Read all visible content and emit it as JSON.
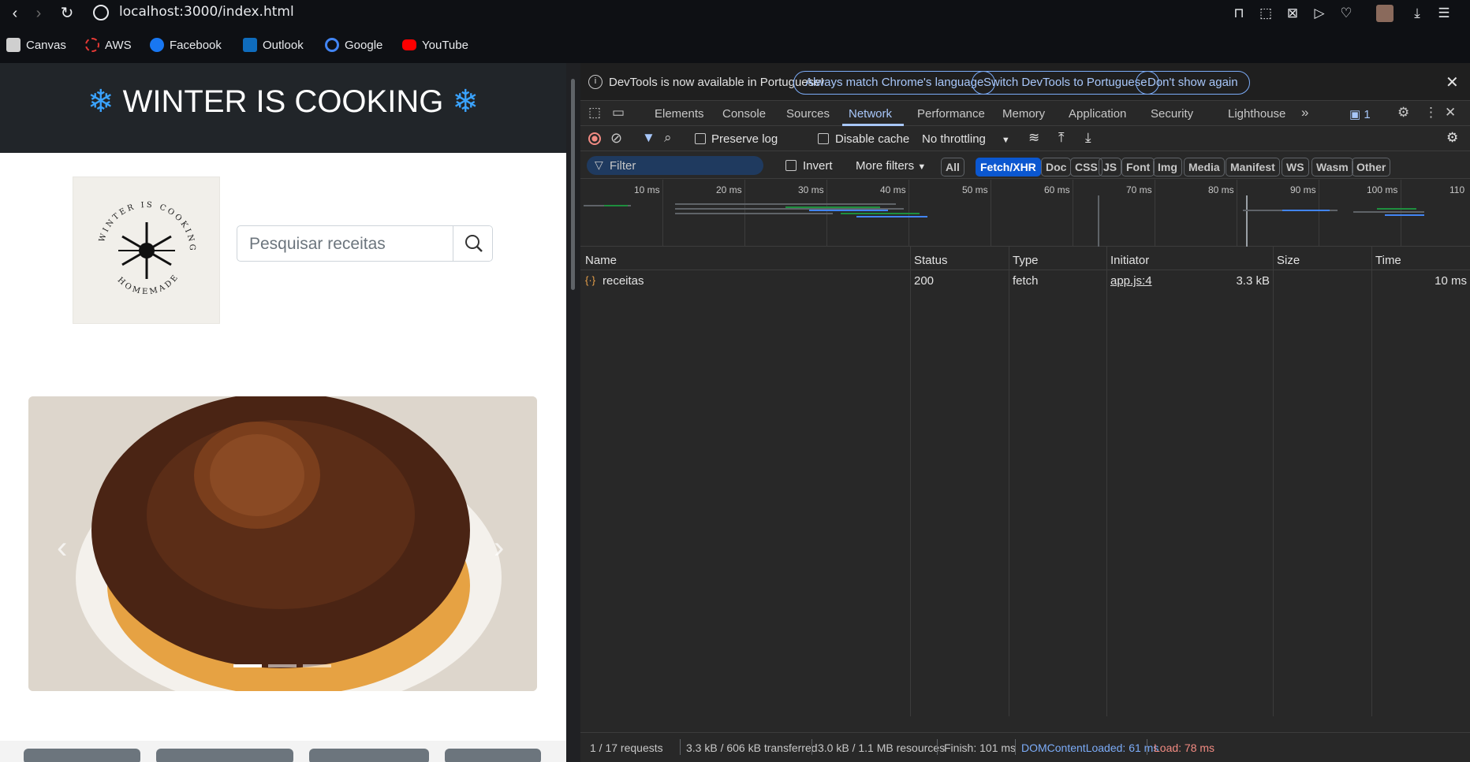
{
  "browser": {
    "url": "localhost:3000/index.html"
  },
  "bookmarks": [
    {
      "label": "Canvas",
      "color": "#cfcfcf"
    },
    {
      "label": "AWS",
      "color": "#e53935"
    },
    {
      "label": "Facebook",
      "color": "#1877f2"
    },
    {
      "label": "Outlook",
      "color": "#0f6cbd"
    },
    {
      "label": "Google",
      "color": "#4285f4"
    },
    {
      "label": "YouTube",
      "color": "#ff0000"
    }
  ],
  "site": {
    "title": "WINTER IS COOKING",
    "snow_icon": "❄",
    "logo_text_top": "WINTER IS COOKING",
    "logo_text_bottom": "HOMEMADE",
    "search_placeholder": "Pesquisar receitas"
  },
  "devtools": {
    "info_text": "DevTools is now available in Portuguese!",
    "btn_match": "Always match Chrome's language",
    "btn_switch": "Switch DevTools to Portuguese",
    "btn_dont": "Don't show again",
    "tabs": [
      "Elements",
      "Console",
      "Sources",
      "Network",
      "Performance",
      "Memory",
      "Application",
      "Security",
      "Lighthouse"
    ],
    "active_tab": "Network",
    "issues_count": "1",
    "toolbar": {
      "preserve_log": "Preserve log",
      "disable_cache": "Disable cache",
      "throttling": "No throttling"
    },
    "filter": {
      "placeholder": "Filter",
      "invert": "Invert",
      "more_filters": "More filters"
    },
    "chips": [
      "All",
      "Fetch/XHR",
      "Doc",
      "CSS",
      "JS",
      "Font",
      "Img",
      "Media",
      "Manifest",
      "WS",
      "Wasm",
      "Other"
    ],
    "selected_chip": "Fetch/XHR",
    "timeline_ticks": [
      "10 ms",
      "20 ms",
      "30 ms",
      "40 ms",
      "50 ms",
      "60 ms",
      "70 ms",
      "80 ms",
      "90 ms",
      "100 ms",
      "110"
    ],
    "columns": [
      "Name",
      "Status",
      "Type",
      "Initiator",
      "Size",
      "Time"
    ],
    "rows": [
      {
        "name": "receitas",
        "status": "200",
        "type": "fetch",
        "initiator": "app.js:4",
        "size": "3.3 kB",
        "time": "10 ms"
      }
    ],
    "status": {
      "requests": "1 / 17 requests",
      "transferred": "3.3 kB / 606 kB transferred",
      "resources": "3.0 kB / 1.1 MB resources",
      "finish": "Finish: 101 ms",
      "dcl": "DOMContentLoaded: 61 ms",
      "load": "Load: 78 ms"
    }
  }
}
